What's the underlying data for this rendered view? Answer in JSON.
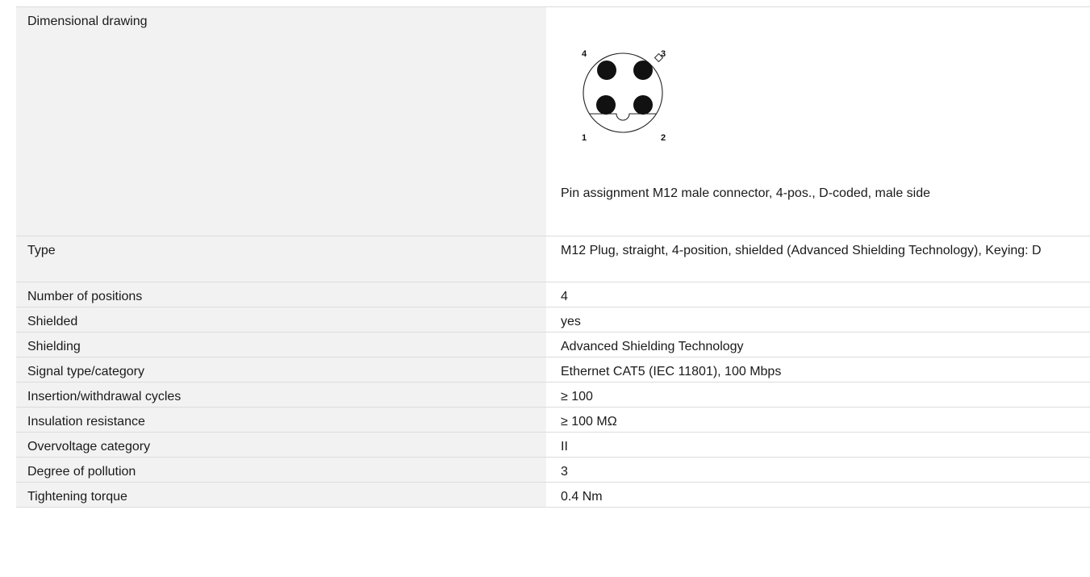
{
  "drawing": {
    "label": "Dimensional drawing",
    "caption": "Pin assignment M12 male connector, 4-pos., D-coded, male side",
    "pins": [
      "1",
      "2",
      "3",
      "4"
    ]
  },
  "rows": [
    {
      "label": "Type",
      "value": "M12 Plug, straight, 4-position, shielded (Advanced Shielding Technology), Keying: D"
    },
    {
      "label": "Number of positions",
      "value": "4"
    },
    {
      "label": "Shielded",
      "value": "yes"
    },
    {
      "label": "Shielding",
      "value": "Advanced Shielding Technology"
    },
    {
      "label": "Signal type/category",
      "value": "Ethernet CAT5 (IEC 11801), 100 Mbps"
    },
    {
      "label": "Insertion/withdrawal cycles",
      "value": "≥ 100"
    },
    {
      "label": "Insulation resistance",
      "value": "≥ 100 MΩ"
    },
    {
      "label": "Overvoltage category",
      "value": "II"
    },
    {
      "label": "Degree of pollution",
      "value": "3"
    },
    {
      "label": "Tightening torque",
      "value": "0.4 Nm"
    }
  ]
}
